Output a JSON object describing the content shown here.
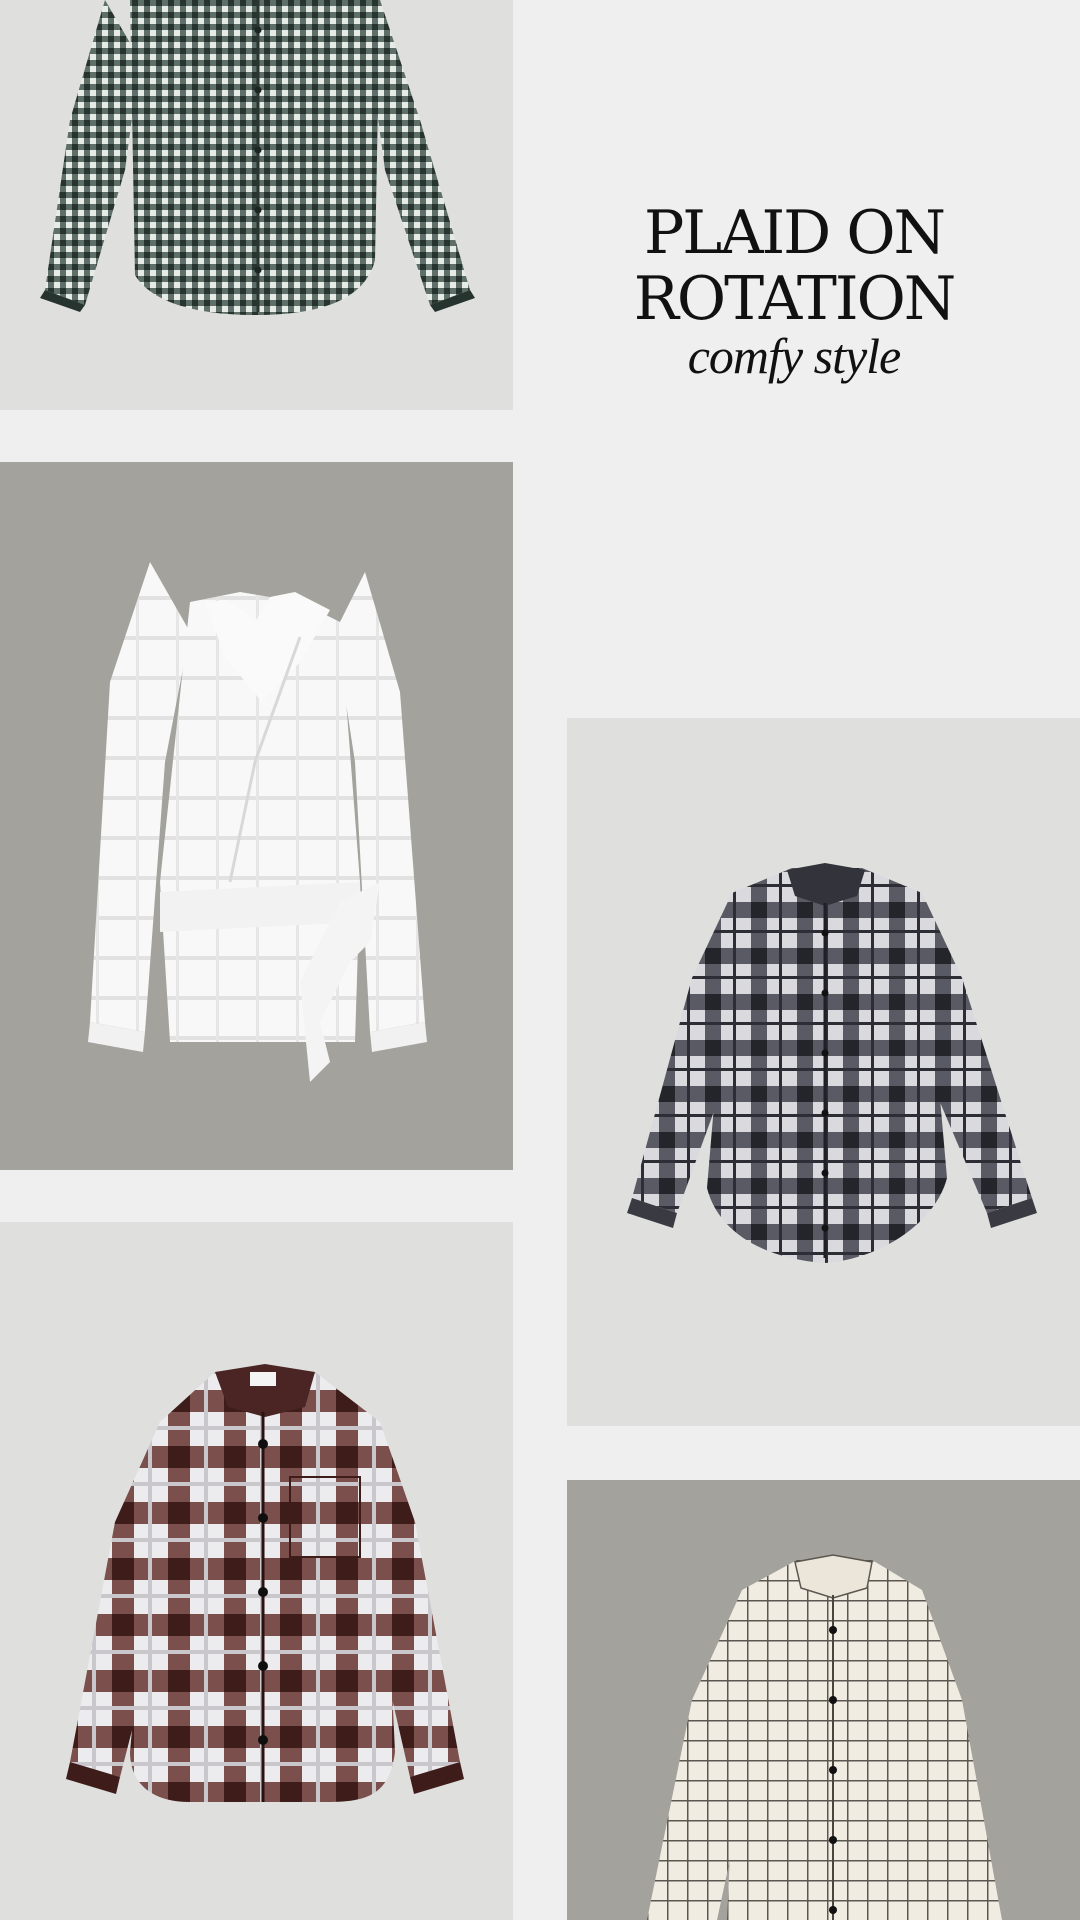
{
  "title": {
    "line1": "PLAID ON",
    "line2": "ROTATION",
    "subtitle": "comfy style"
  },
  "colors": {
    "page_background": "#efefef",
    "light_panel": "#dfdfdd",
    "dark_panel": "#a3a29c",
    "text": "#111111"
  },
  "items": [
    {
      "description": "navy-green gingham button-down shirt",
      "shirt_color": "#3c4a46"
    },
    {
      "description": "white tonal plaid wrap blouse with side tie",
      "shirt_color": "#f6f6f6"
    },
    {
      "description": "black and white plaid oversized shirt",
      "shirt_color": "#4a4a52"
    },
    {
      "description": "brown and white plaid overshirt",
      "shirt_color": "#4a2a28"
    },
    {
      "description": "cream windowpane check shirt",
      "shirt_color": "#ece6da"
    }
  ]
}
